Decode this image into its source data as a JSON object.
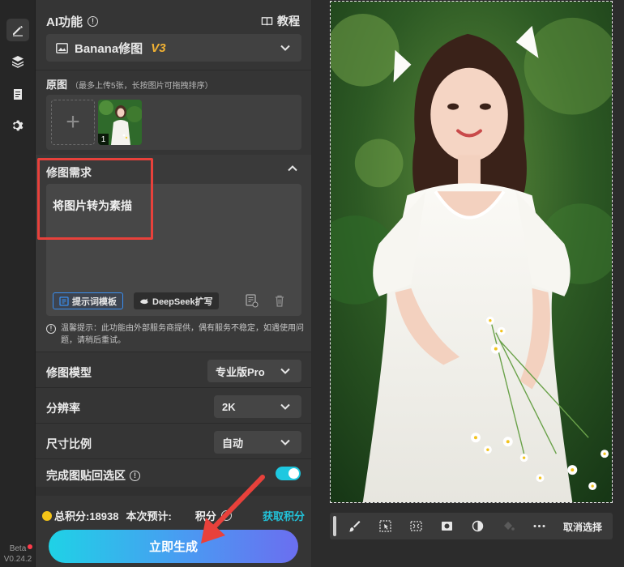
{
  "sidebar": {
    "items": [
      {
        "name": "edit",
        "icon": "pen-icon",
        "active": true
      },
      {
        "name": "layers",
        "icon": "layers-icon",
        "active": false
      },
      {
        "name": "history",
        "icon": "clipboard-icon",
        "active": false
      },
      {
        "name": "settings",
        "icon": "gear-icon",
        "active": false
      }
    ],
    "beta_label": "Beta",
    "version": "V0.24.2"
  },
  "panel": {
    "title": "AI功能",
    "tutorial_label": "教程",
    "model_select": {
      "label": "Banana修图",
      "version": "V3"
    },
    "original": {
      "title": "原图",
      "hint": "（最多上传5张，长按图片可拖拽排序）",
      "thumb_index": "1"
    },
    "edit_request": {
      "title": "修图需求",
      "text": "将图片转为素描",
      "template_button": "提示词模板",
      "deepseek_button": "DeepSeek扩写",
      "tip": "温馨提示：此功能由外部服务商提供，偶有服务不稳定，如遇使用问题，请稍后重试。"
    },
    "options": {
      "model": {
        "label": "修图模型",
        "value": "专业版Pro"
      },
      "resolution": {
        "label": "分辨率",
        "value": "2K"
      },
      "ratio": {
        "label": "尺寸比例",
        "value": "自动"
      },
      "paste_back": {
        "label": "完成图贴回选区",
        "enabled": true
      }
    },
    "credits": {
      "total": "总积分:18938",
      "estimate": "本次预计:",
      "estimate_suffix": "积分",
      "get_label": "获取积分"
    },
    "generate_button": "立即生成"
  },
  "toolbar": {
    "icons": [
      "brush-icon",
      "select-icon",
      "expand-selection-icon",
      "mask-icon",
      "contrast-icon",
      "bucket-icon",
      "more-icon"
    ],
    "deselect_label": "取消选择"
  },
  "colors": {
    "accent": "#22c3da",
    "highlight_box": "#e8413b",
    "version_tag": "#f2b233",
    "panel_bg": "#353535"
  }
}
